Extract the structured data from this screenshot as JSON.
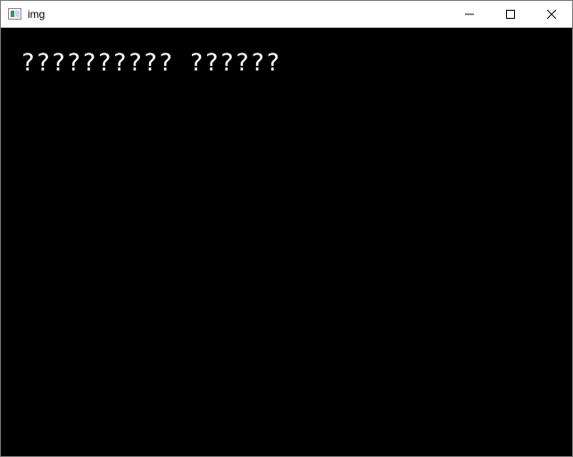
{
  "window": {
    "title": "img",
    "icon": "app-window-icon"
  },
  "caption_buttons": {
    "minimize_icon": "minimize-icon",
    "maximize_icon": "maximize-icon",
    "close_icon": "close-icon"
  },
  "canvas": {
    "background": "#000000",
    "text_color": "#ffffff",
    "text": "?????????? ??????"
  }
}
